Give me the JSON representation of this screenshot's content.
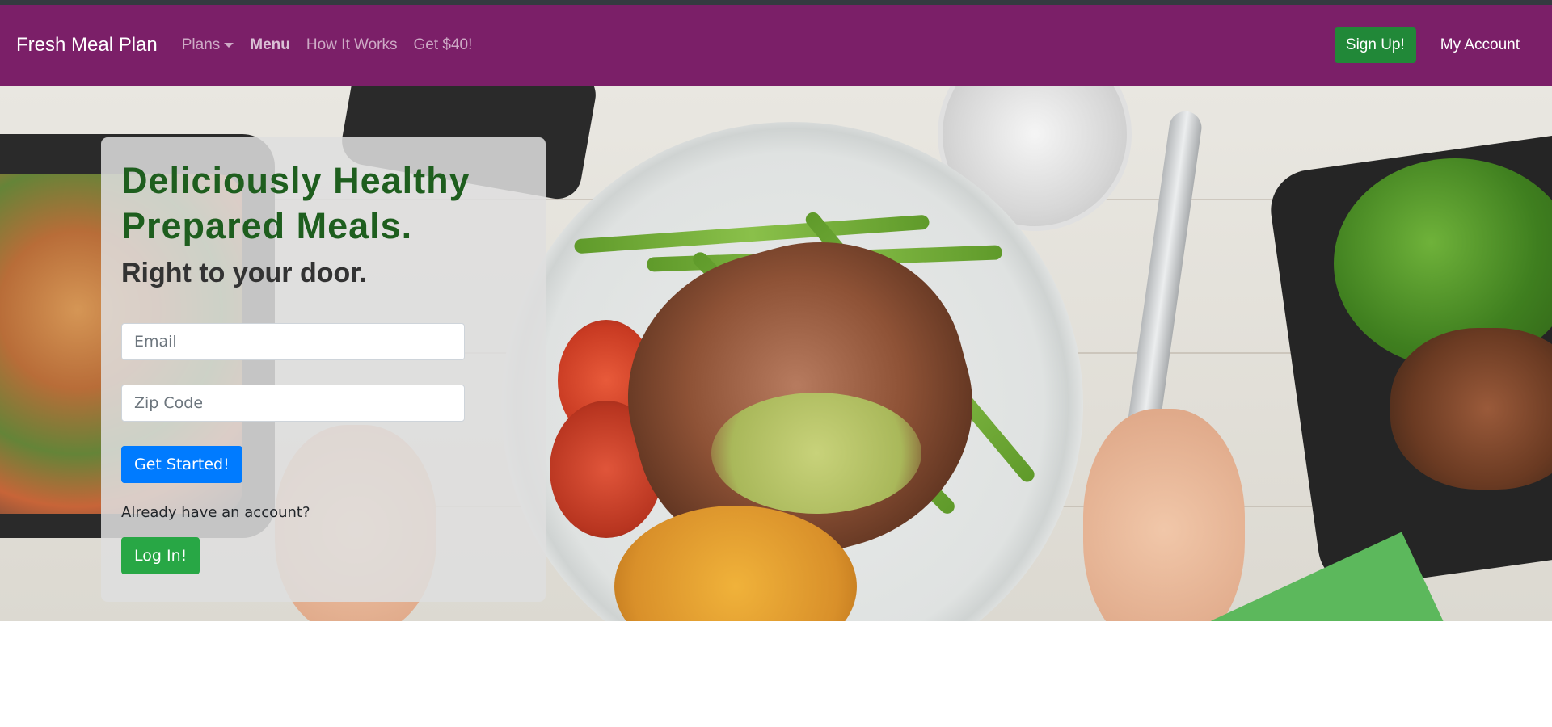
{
  "navbar": {
    "brand": "Fresh Meal Plan",
    "links": [
      {
        "label": "Plans",
        "dropdown": true
      },
      {
        "label": "Menu",
        "active": true
      },
      {
        "label": "How It Works"
      },
      {
        "label": "Get $40!"
      }
    ],
    "signup_label": "Sign Up!",
    "account_label": "My Account",
    "background_color": "#7b1f68"
  },
  "hero": {
    "headline_line1": "Deliciously Healthy",
    "headline_line2": "Prepared Meals.",
    "subheadline": "Right to your door.",
    "email_placeholder": "Email",
    "zip_placeholder": "Zip Code",
    "get_started_label": "Get Started!",
    "already_text": "Already have an account?",
    "login_label": "Log In!"
  },
  "colors": {
    "headline": "#1e5e1e",
    "primary_button": "#007bff",
    "success_button": "#28a745",
    "signup_button": "#218838"
  }
}
